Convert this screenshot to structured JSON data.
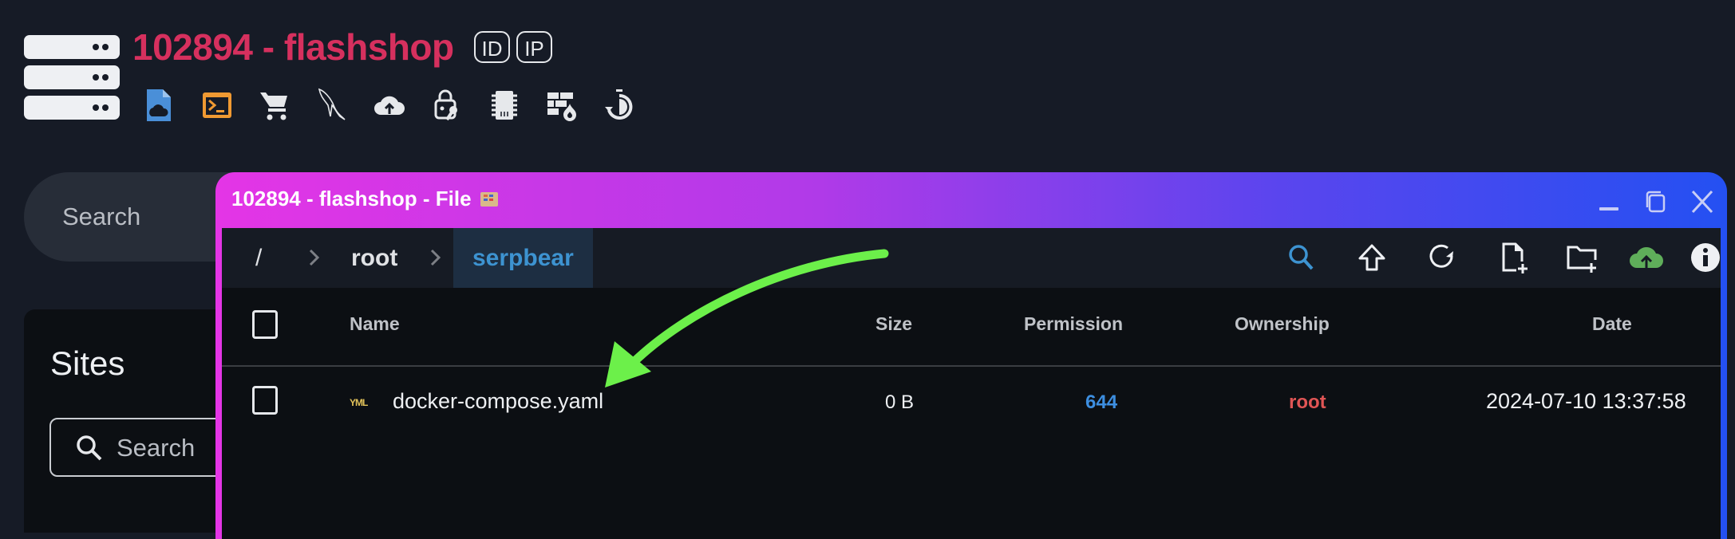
{
  "header": {
    "title": "102894 - flashshop",
    "badges": [
      "ID",
      "IP"
    ],
    "tools": [
      {
        "name": "file-cloud-icon",
        "color": "#4a8fd8"
      },
      {
        "name": "terminal-icon",
        "color": "#f09a32"
      },
      {
        "name": "cart-icon",
        "color": "#e6e8eb"
      },
      {
        "name": "mysql-dolphin-icon",
        "color": "#e6e8eb"
      },
      {
        "name": "cloud-upload-icon",
        "color": "#e6e8eb"
      },
      {
        "name": "lock-key-icon",
        "color": "#e6e8eb"
      },
      {
        "name": "memory-chip-icon",
        "color": "#e6e8eb"
      },
      {
        "name": "firewall-icon",
        "color": "#e6e8eb"
      },
      {
        "name": "timer-icon",
        "color": "#e6e8eb"
      }
    ]
  },
  "search": {
    "placeholder": "Search"
  },
  "sites": {
    "title": "Sites",
    "search_placeholder": "Search"
  },
  "file_window": {
    "title": "102894 - flashshop - File",
    "breadcrumb": [
      "/",
      "root",
      "serpbear"
    ],
    "toolbar": [
      "search-icon",
      "up-directory-icon",
      "refresh-icon",
      "new-file-icon",
      "new-folder-icon",
      "upload-icon",
      "info-icon"
    ],
    "columns": {
      "name": "Name",
      "size": "Size",
      "permission": "Permission",
      "ownership": "Ownership",
      "date": "Date"
    },
    "files": [
      {
        "type_label": "YML",
        "name": "docker-compose.yaml",
        "size": "0 B",
        "permission": "644",
        "owner": "root",
        "date": "2024-07-10 13:37:58"
      }
    ]
  },
  "colors": {
    "title_red": "#d6305e",
    "permission_blue": "#3d8ee0",
    "owner_red": "#e05555",
    "breadcrumb_active": "#3d93d1",
    "upload_green": "#5fae5a",
    "annotation_arrow": "#6cf04a"
  }
}
